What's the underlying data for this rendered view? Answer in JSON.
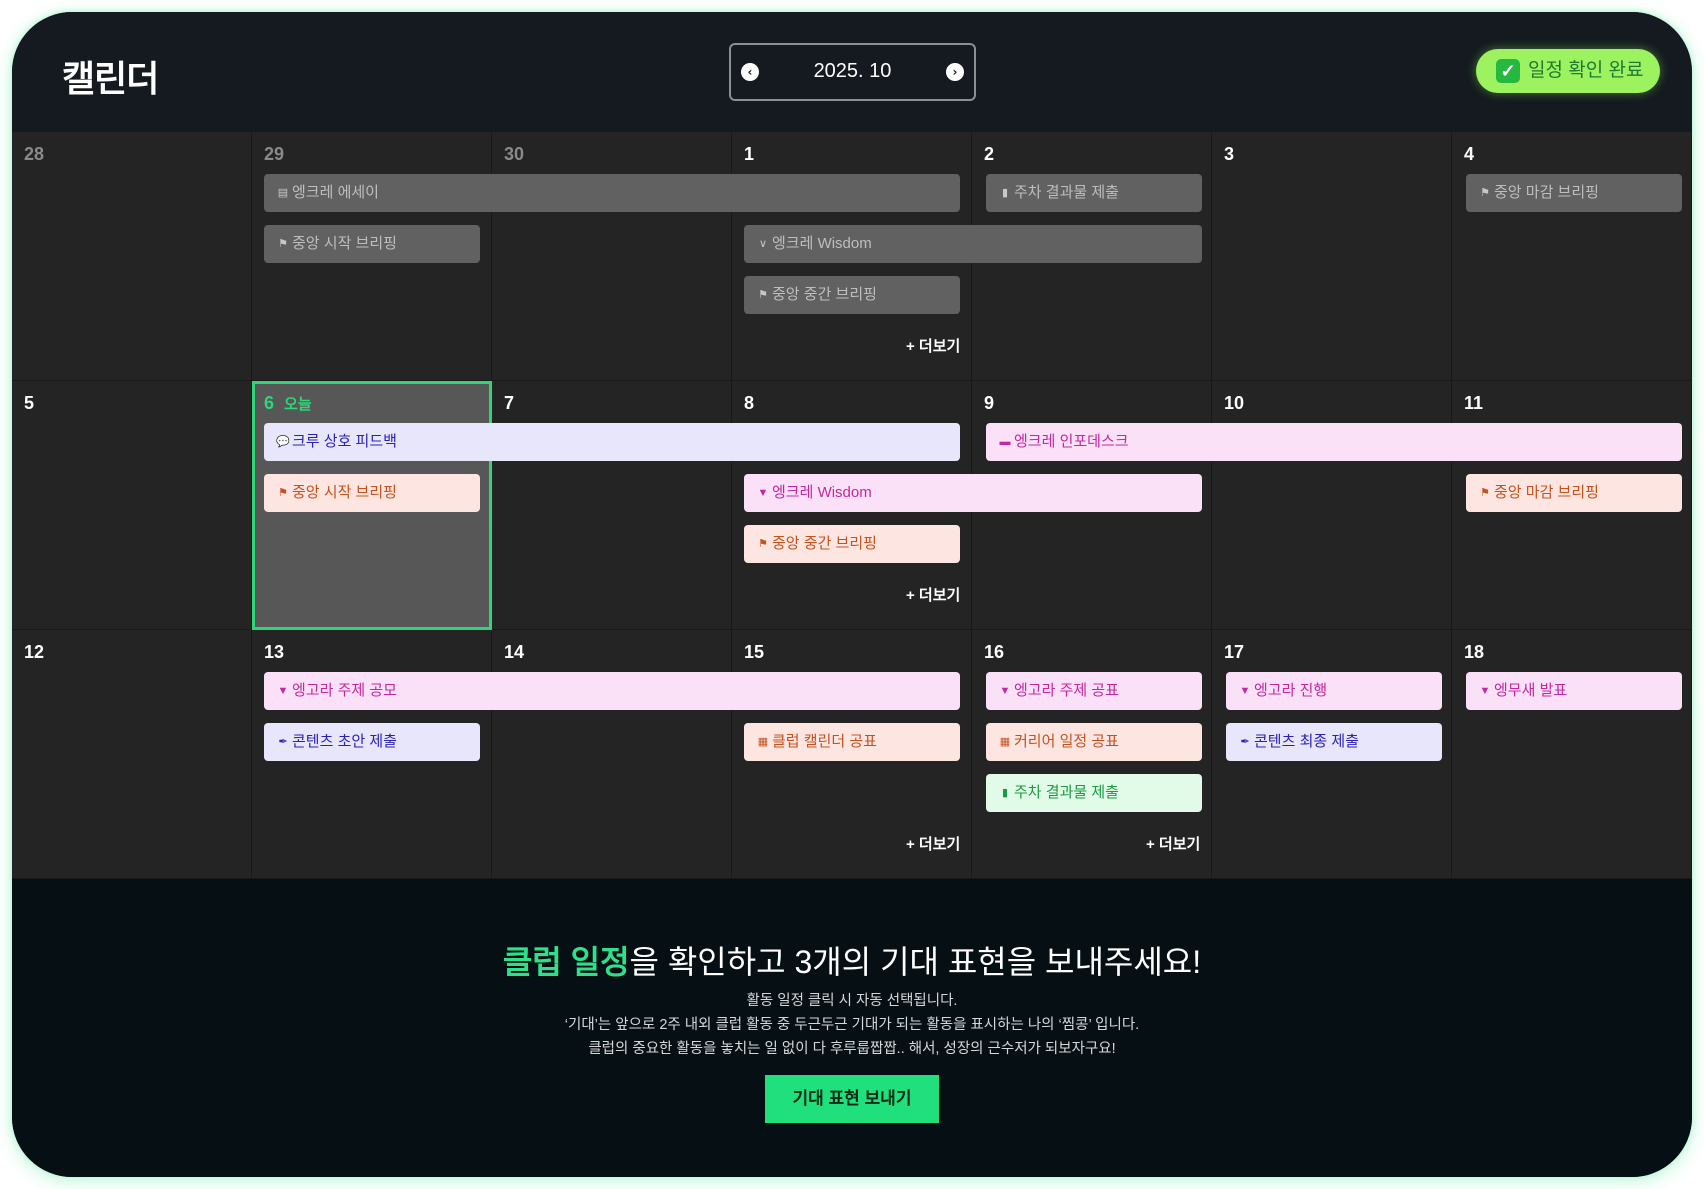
{
  "header": {
    "title": "캘린더",
    "month": "2025. 10",
    "confirm_label": "일정 확인 완료"
  },
  "calendar": {
    "today_label": "오늘",
    "more_label": "+ 더보기",
    "weeks": [
      [
        "28",
        "29",
        "30",
        "1",
        "2",
        "3",
        "4"
      ],
      [
        "5",
        "6",
        "7",
        "8",
        "9",
        "10",
        "11"
      ],
      [
        "12",
        "13",
        "14",
        "15",
        "16",
        "17",
        "18"
      ]
    ],
    "events": {
      "w1": {
        "essay": "엥크레 에세이",
        "weekly_submit": "주차 결과물 제출",
        "start_briefing": "중앙 시작 브리핑",
        "wisdom": "엥크레 Wisdom",
        "mid_briefing": "중앙 중간 브리핑",
        "end_briefing": "중앙 마감 브리핑"
      },
      "w2": {
        "crew_feedback": "크루 상호 피드백",
        "infodesk": "엥크레 인포데스크",
        "start_briefing": "중앙 시작 브리핑",
        "wisdom": "엥크레 Wisdom",
        "end_briefing": "중앙 마감 브리핑",
        "mid_briefing": "중앙 중간 브리핑"
      },
      "w3": {
        "topic_contest": "엥고라 주제 공모",
        "topic_announce": "엥고라 주제 공표",
        "engora_progress": "엥고라 진행",
        "emusae": "엥무새 발표",
        "content_draft": "콘텐츠 초안 제출",
        "club_calendar": "클럽 캘린더 공표",
        "career_schedule": "커리어 일정 공표",
        "content_final": "콘텐츠 최종 제출",
        "weekly_submit": "주차 결과물 제출"
      }
    }
  },
  "footer": {
    "title_highlight": "클럽 일정",
    "title_rest": "을 확인하고 3개의 기대 표현을 보내주세요!",
    "desc_line1": "활동 일정 클릭 시 자동 선택됩니다.",
    "desc_line2": "‘기대’는 앞으로 2주 내외 클럽 활동 중 두근두근 기대가 되는 활동을 표시하는 나의 ‘찜콩’ 입니다.",
    "desc_line3": "클럽의 중요한 활동을 놓치는 일 없이 다 후루룹짭짭.. 해서, 성장의 근수저가 되보자구요!",
    "button_label": "기대 표현 보내기"
  },
  "colors": {
    "accent_green": "#2fd577",
    "confirm_button": "#9df25f",
    "event_gray": "#616161",
    "event_lavender": "#e8e6fb",
    "event_pink": "#fbe1f8",
    "event_peach": "#fde6e2",
    "event_green": "#e1fbe8"
  }
}
